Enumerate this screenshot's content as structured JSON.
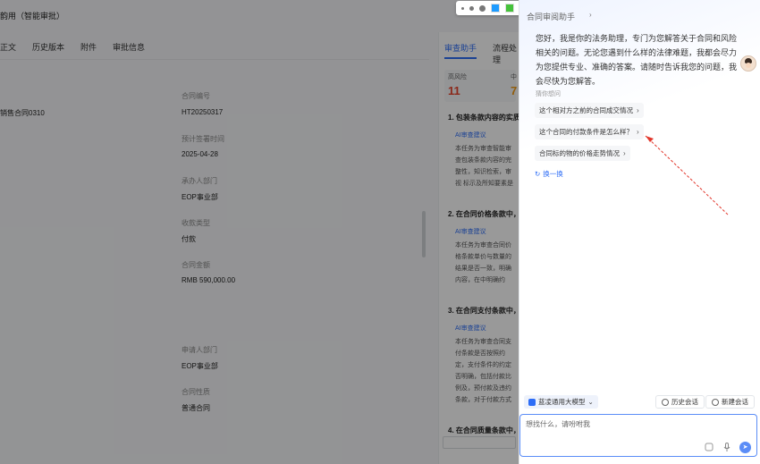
{
  "base": {
    "title": "韵用（智能审批）",
    "tabs": [
      "正文",
      "历史版本",
      "附件",
      "审批信息"
    ],
    "contract_name": "销售合同0310",
    "fields": [
      {
        "label": "合同编号",
        "value": "HT20250317"
      },
      {
        "label": "预计签署时间",
        "value": "2025-04-28"
      },
      {
        "label": "承办人部门",
        "value": "EOP事业部"
      },
      {
        "label": "收款类型",
        "value": "付款"
      },
      {
        "label": "合同金额",
        "value": "RMB 590,000.00"
      },
      {
        "label": "申请人部门",
        "value": "EOP事业部"
      },
      {
        "label": "合同性质",
        "value": "普通合同"
      }
    ]
  },
  "review": {
    "tabs": [
      "审查助手",
      "流程处理"
    ],
    "risk_high_label": "高风险",
    "risk_high": "11",
    "risk_mid_label": "中",
    "risk_mid": "7",
    "sections": [
      {
        "title": "1. 包装条款内容的实质…",
        "tag": "AI审查建议",
        "body": "本任务为审查智能审查包装条款内容的完整性，知识检索，审视 标示及所知要素是否完整，以避免潜在的法律风险及，加工"
      },
      {
        "title": "2. 在合同价格条款中，",
        "tag": "AI审查建议",
        "body": "本任务为审查合同价格条款单价与数量的结果是否一致，明确内容，在中明确约定，以避免潜在的法律风险"
      },
      {
        "title": "3. 在合同支付条款中，",
        "tag": "AI审查建议",
        "body": "本任务为审查合同支付条款是否按照约定，支付条件的约定否明确，包括付款比例及，预付款及违约条款，对于付款方式的约定，且和，以避免潜在的法律风险并加以修正"
      },
      {
        "title": "4. 在合同质量条款中，",
        "tag": "",
        "body": ""
      }
    ]
  },
  "annotation_toolbar": {
    "colors": [
      "#1e9bff",
      "#45c23a",
      "#f5b800",
      "#444444",
      "#ffffff",
      "#ff3b30"
    ]
  },
  "assistant": {
    "title": "合同审阅助手",
    "greeting": "您好，我是你的法务助理，专门为您解答关于合同和风险相关的问题。无论您遇到什么样的法律难题，我都会尽力为您提供专业、准确的答案。请随时告诉我您的问题，我会尽快为您解答。",
    "guess_label": "猜你想问",
    "questions": [
      "这个相对方之前的合同成交情况",
      "这个合同的付款条件是怎么样？",
      "合同标的物的价格走势情况"
    ],
    "refresh": "换一换",
    "model": "蓝凌通用大模型",
    "history": "历史会话",
    "new_chat": "新建会话",
    "input_placeholder": "想找什么，请吩咐我"
  }
}
